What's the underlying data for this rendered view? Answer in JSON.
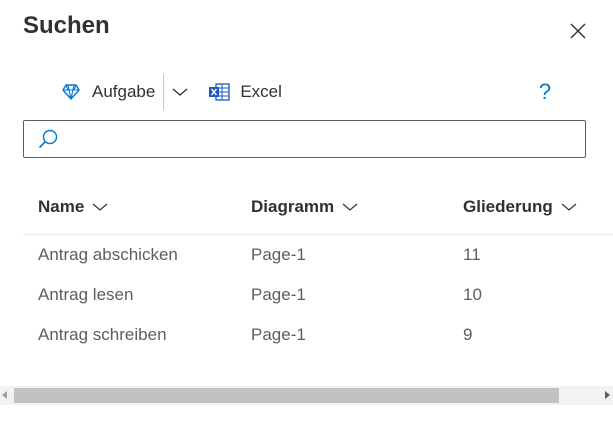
{
  "panel": {
    "title": "Suchen",
    "close_icon": "close-icon"
  },
  "toolbar": {
    "task_label": "Aufgabe",
    "task_icon": "diamond-icon",
    "dropdown_icon": "chevron-down-icon",
    "excel_label": "Excel",
    "excel_icon": "excel-icon",
    "help_label": "?"
  },
  "search": {
    "value": "",
    "icon": "search-icon"
  },
  "grid": {
    "columns": [
      {
        "label": "Name"
      },
      {
        "label": "Diagramm"
      },
      {
        "label": "Gliederung"
      }
    ],
    "rows": [
      {
        "name": "Antrag abschicken",
        "diagram": "Page-1",
        "outline": "11"
      },
      {
        "name": "Antrag lesen",
        "diagram": "Page-1",
        "outline": "10"
      },
      {
        "name": "Antrag schreiben",
        "diagram": "Page-1",
        "outline": "9"
      }
    ]
  },
  "colors": {
    "accent": "#0078d4",
    "excel_green": "#185abd",
    "text": "#323130",
    "muted_text": "#605e5c"
  }
}
